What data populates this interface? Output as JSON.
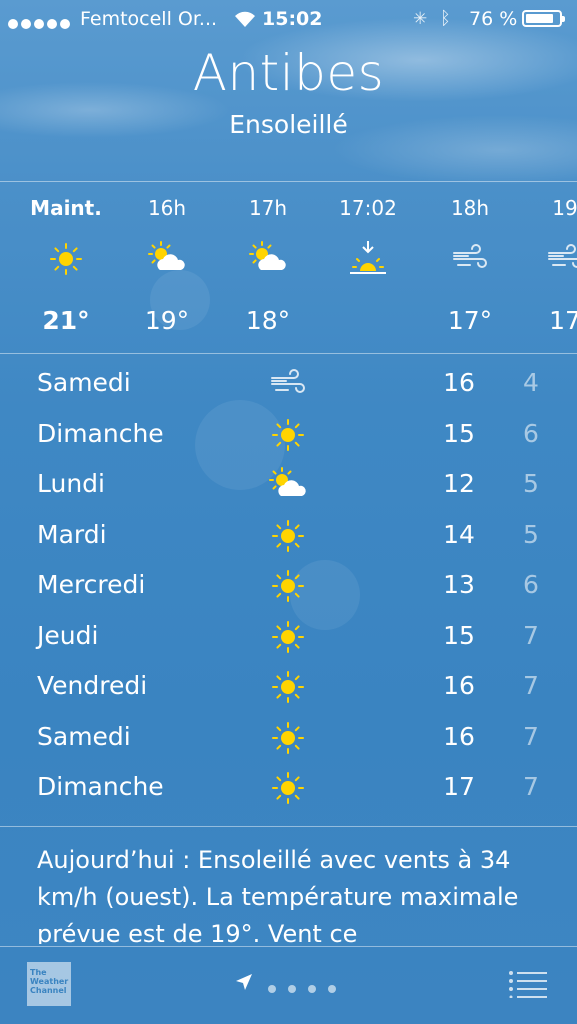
{
  "status_bar": {
    "carrier": "Femtocell Or...",
    "time": "15:02",
    "battery_pct": "76 %",
    "battery_level": 0.76
  },
  "location": {
    "city": "Antibes",
    "condition": "Ensoleillé"
  },
  "hourly": [
    {
      "label": "Maint.",
      "icon": "sun-icon",
      "temp": "21°"
    },
    {
      "label": "16h",
      "icon": "partly-cloudy-icon",
      "temp": "19°"
    },
    {
      "label": "17h",
      "icon": "partly-cloudy-icon",
      "temp": "18°"
    },
    {
      "label": "17:02",
      "icon": "sunset-icon",
      "temp": ""
    },
    {
      "label": "18h",
      "icon": "wind-icon",
      "temp": "17°"
    },
    {
      "label": "19",
      "icon": "wind-icon",
      "temp": "17"
    }
  ],
  "daily": [
    {
      "day": "Samedi",
      "icon": "wind-icon",
      "high": "16",
      "low": "4"
    },
    {
      "day": "Dimanche",
      "icon": "sun-icon",
      "high": "15",
      "low": "6"
    },
    {
      "day": "Lundi",
      "icon": "partly-cloudy-icon",
      "high": "12",
      "low": "5"
    },
    {
      "day": "Mardi",
      "icon": "sun-icon",
      "high": "14",
      "low": "5"
    },
    {
      "day": "Mercredi",
      "icon": "sun-icon",
      "high": "13",
      "low": "6"
    },
    {
      "day": "Jeudi",
      "icon": "sun-icon",
      "high": "15",
      "low": "7"
    },
    {
      "day": "Vendredi",
      "icon": "sun-icon",
      "high": "16",
      "low": "7"
    },
    {
      "day": "Samedi",
      "icon": "sun-icon",
      "high": "16",
      "low": "7"
    },
    {
      "day": "Dimanche",
      "icon": "sun-icon",
      "high": "17",
      "low": "7"
    }
  ],
  "summary": "Aujourd’hui : Ensoleillé avec vents à 34 km/h (ouest). La température maximale prévue est de 19°. Vent ce",
  "toolbar": {
    "provider_logo": "The Weather Channel",
    "page_count": 4
  },
  "colors": {
    "background": "#3f88c4",
    "sun": "#ffd400",
    "text": "#ffffff"
  }
}
